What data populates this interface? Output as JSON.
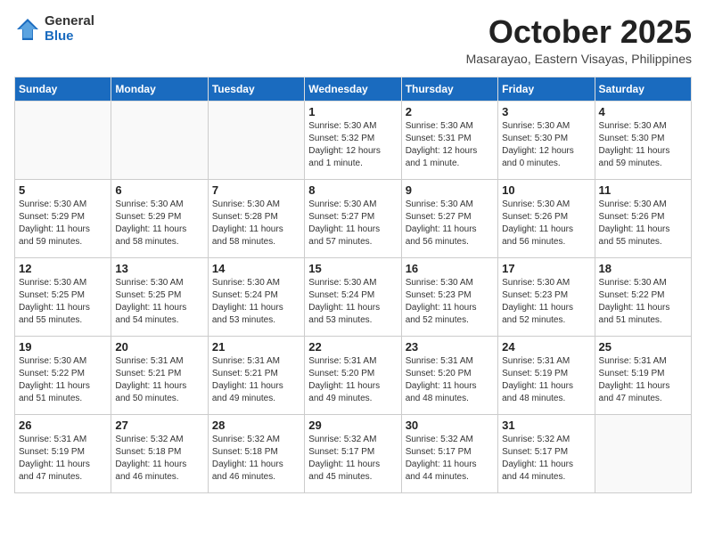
{
  "logo": {
    "general": "General",
    "blue": "Blue"
  },
  "title": "October 2025",
  "location": "Masarayao, Eastern Visayas, Philippines",
  "weekdays": [
    "Sunday",
    "Monday",
    "Tuesday",
    "Wednesday",
    "Thursday",
    "Friday",
    "Saturday"
  ],
  "weeks": [
    [
      {
        "day": "",
        "info": ""
      },
      {
        "day": "",
        "info": ""
      },
      {
        "day": "",
        "info": ""
      },
      {
        "day": "1",
        "info": "Sunrise: 5:30 AM\nSunset: 5:32 PM\nDaylight: 12 hours\nand 1 minute."
      },
      {
        "day": "2",
        "info": "Sunrise: 5:30 AM\nSunset: 5:31 PM\nDaylight: 12 hours\nand 1 minute."
      },
      {
        "day": "3",
        "info": "Sunrise: 5:30 AM\nSunset: 5:30 PM\nDaylight: 12 hours\nand 0 minutes."
      },
      {
        "day": "4",
        "info": "Sunrise: 5:30 AM\nSunset: 5:30 PM\nDaylight: 11 hours\nand 59 minutes."
      }
    ],
    [
      {
        "day": "5",
        "info": "Sunrise: 5:30 AM\nSunset: 5:29 PM\nDaylight: 11 hours\nand 59 minutes."
      },
      {
        "day": "6",
        "info": "Sunrise: 5:30 AM\nSunset: 5:29 PM\nDaylight: 11 hours\nand 58 minutes."
      },
      {
        "day": "7",
        "info": "Sunrise: 5:30 AM\nSunset: 5:28 PM\nDaylight: 11 hours\nand 58 minutes."
      },
      {
        "day": "8",
        "info": "Sunrise: 5:30 AM\nSunset: 5:27 PM\nDaylight: 11 hours\nand 57 minutes."
      },
      {
        "day": "9",
        "info": "Sunrise: 5:30 AM\nSunset: 5:27 PM\nDaylight: 11 hours\nand 56 minutes."
      },
      {
        "day": "10",
        "info": "Sunrise: 5:30 AM\nSunset: 5:26 PM\nDaylight: 11 hours\nand 56 minutes."
      },
      {
        "day": "11",
        "info": "Sunrise: 5:30 AM\nSunset: 5:26 PM\nDaylight: 11 hours\nand 55 minutes."
      }
    ],
    [
      {
        "day": "12",
        "info": "Sunrise: 5:30 AM\nSunset: 5:25 PM\nDaylight: 11 hours\nand 55 minutes."
      },
      {
        "day": "13",
        "info": "Sunrise: 5:30 AM\nSunset: 5:25 PM\nDaylight: 11 hours\nand 54 minutes."
      },
      {
        "day": "14",
        "info": "Sunrise: 5:30 AM\nSunset: 5:24 PM\nDaylight: 11 hours\nand 53 minutes."
      },
      {
        "day": "15",
        "info": "Sunrise: 5:30 AM\nSunset: 5:24 PM\nDaylight: 11 hours\nand 53 minutes."
      },
      {
        "day": "16",
        "info": "Sunrise: 5:30 AM\nSunset: 5:23 PM\nDaylight: 11 hours\nand 52 minutes."
      },
      {
        "day": "17",
        "info": "Sunrise: 5:30 AM\nSunset: 5:23 PM\nDaylight: 11 hours\nand 52 minutes."
      },
      {
        "day": "18",
        "info": "Sunrise: 5:30 AM\nSunset: 5:22 PM\nDaylight: 11 hours\nand 51 minutes."
      }
    ],
    [
      {
        "day": "19",
        "info": "Sunrise: 5:30 AM\nSunset: 5:22 PM\nDaylight: 11 hours\nand 51 minutes."
      },
      {
        "day": "20",
        "info": "Sunrise: 5:31 AM\nSunset: 5:21 PM\nDaylight: 11 hours\nand 50 minutes."
      },
      {
        "day": "21",
        "info": "Sunrise: 5:31 AM\nSunset: 5:21 PM\nDaylight: 11 hours\nand 49 minutes."
      },
      {
        "day": "22",
        "info": "Sunrise: 5:31 AM\nSunset: 5:20 PM\nDaylight: 11 hours\nand 49 minutes."
      },
      {
        "day": "23",
        "info": "Sunrise: 5:31 AM\nSunset: 5:20 PM\nDaylight: 11 hours\nand 48 minutes."
      },
      {
        "day": "24",
        "info": "Sunrise: 5:31 AM\nSunset: 5:19 PM\nDaylight: 11 hours\nand 48 minutes."
      },
      {
        "day": "25",
        "info": "Sunrise: 5:31 AM\nSunset: 5:19 PM\nDaylight: 11 hours\nand 47 minutes."
      }
    ],
    [
      {
        "day": "26",
        "info": "Sunrise: 5:31 AM\nSunset: 5:19 PM\nDaylight: 11 hours\nand 47 minutes."
      },
      {
        "day": "27",
        "info": "Sunrise: 5:32 AM\nSunset: 5:18 PM\nDaylight: 11 hours\nand 46 minutes."
      },
      {
        "day": "28",
        "info": "Sunrise: 5:32 AM\nSunset: 5:18 PM\nDaylight: 11 hours\nand 46 minutes."
      },
      {
        "day": "29",
        "info": "Sunrise: 5:32 AM\nSunset: 5:17 PM\nDaylight: 11 hours\nand 45 minutes."
      },
      {
        "day": "30",
        "info": "Sunrise: 5:32 AM\nSunset: 5:17 PM\nDaylight: 11 hours\nand 44 minutes."
      },
      {
        "day": "31",
        "info": "Sunrise: 5:32 AM\nSunset: 5:17 PM\nDaylight: 11 hours\nand 44 minutes."
      },
      {
        "day": "",
        "info": ""
      }
    ]
  ]
}
